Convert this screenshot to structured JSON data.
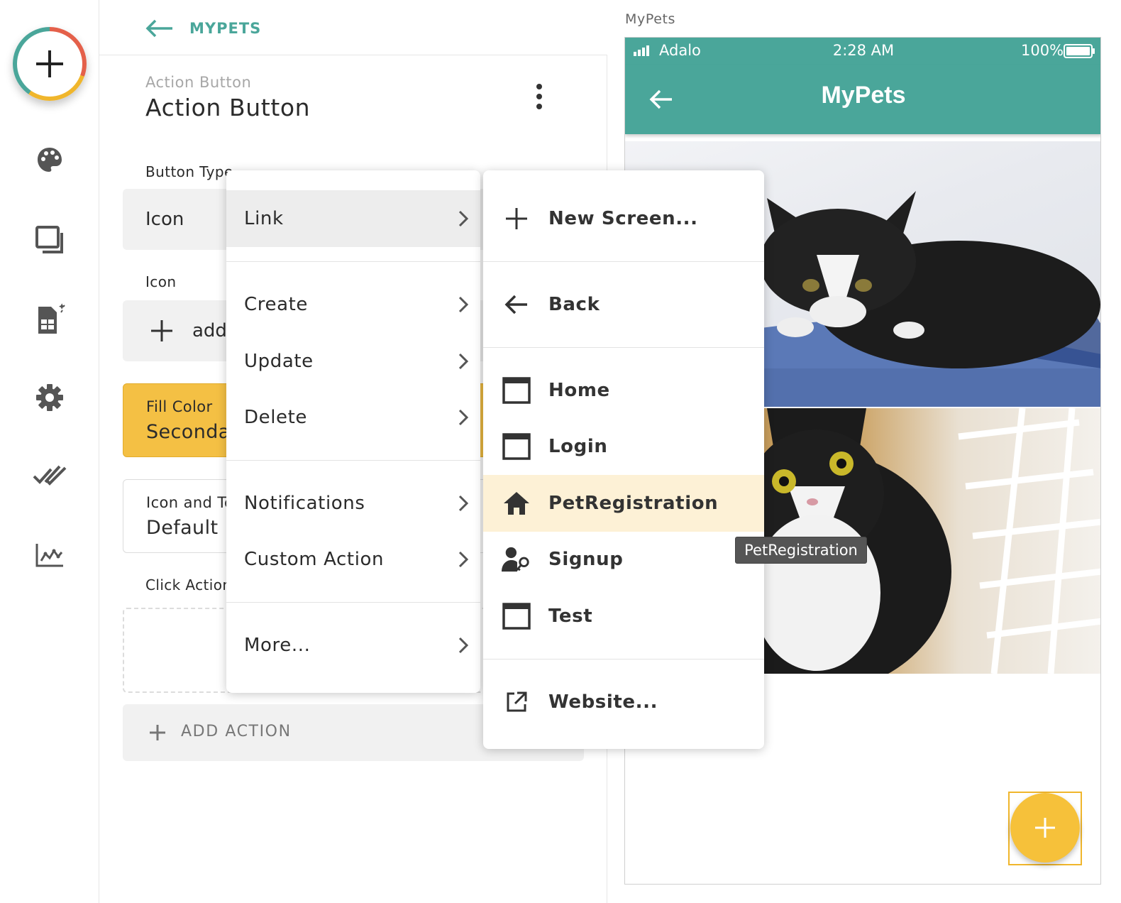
{
  "sidebar": {
    "icons": [
      "add-icon",
      "palette-icon",
      "screens-icon",
      "database-icon",
      "settings-icon",
      "publish-icon",
      "analytics-icon"
    ]
  },
  "header": {
    "back_label": "MYPETS"
  },
  "component": {
    "subtitle": "Action Button",
    "title": "Action Button"
  },
  "properties": {
    "button_type_label": "Button Type",
    "button_type_value": "Icon",
    "icon_label": "Icon",
    "icon_add": "add",
    "fill_color_label": "Fill Color",
    "fill_color_value": "Secondary",
    "icon_text_label": "Icon and Text Color",
    "icon_text_value": "Default Background",
    "click_actions_label": "Click Actions",
    "add_action_label": "ADD ACTION"
  },
  "action_menu": {
    "items": [
      {
        "label": "Link"
      },
      {
        "label": "Create"
      },
      {
        "label": "Update"
      },
      {
        "label": "Delete"
      },
      {
        "label": "Notifications"
      },
      {
        "label": "Custom Action"
      },
      {
        "label": "More..."
      }
    ]
  },
  "link_menu": {
    "items": [
      {
        "label": "New Screen...",
        "icon": "plus-icon"
      },
      {
        "label": "Back",
        "icon": "arrow-left-icon"
      },
      {
        "label": "Home",
        "icon": "screen-icon"
      },
      {
        "label": "Login",
        "icon": "screen-icon"
      },
      {
        "label": "PetRegistration",
        "icon": "home-icon",
        "highlighted": true
      },
      {
        "label": "Signup",
        "icon": "user-key-icon"
      },
      {
        "label": "Test",
        "icon": "screen-icon"
      },
      {
        "label": "Website...",
        "icon": "external-link-icon"
      }
    ]
  },
  "tooltip": "PetRegistration",
  "preview": {
    "caption": "MyPets",
    "status": {
      "carrier": "Adalo",
      "time": "2:28 AM",
      "battery": "100%"
    },
    "app_title": "MyPets"
  },
  "colors": {
    "accent": "#4aa69a",
    "highlight": "#fdf1d6",
    "fill_color": "#f4c044"
  }
}
